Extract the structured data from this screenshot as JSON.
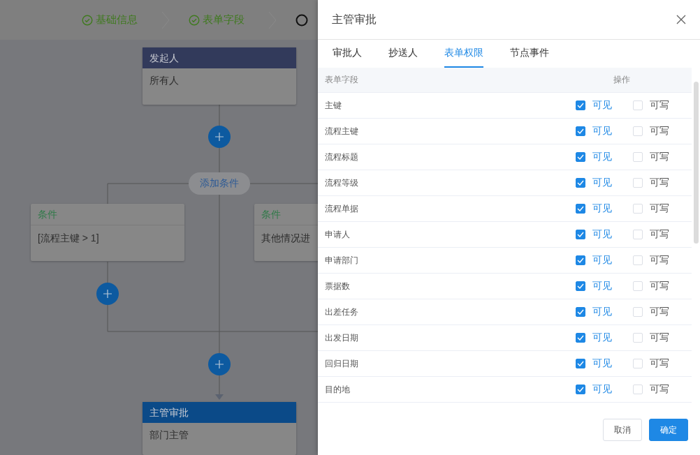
{
  "steps": [
    {
      "label": "基础信息",
      "done": true
    },
    {
      "label": "表单字段",
      "done": true
    },
    {
      "done": false
    }
  ],
  "flow": {
    "start_node": {
      "title": "发起人",
      "content": "所有人"
    },
    "add_condition": "添加条件",
    "conditions": [
      {
        "title": "条件",
        "content": "[流程主键 > 1]"
      },
      {
        "title": "条件",
        "content": "其他情况进"
      }
    ],
    "approver_node": {
      "title": "主管审批",
      "content": "部门主管"
    }
  },
  "drawer": {
    "title": "主管审批",
    "tabs": [
      {
        "label": "审批人",
        "selected": false
      },
      {
        "label": "抄送人",
        "selected": false
      },
      {
        "label": "表单权限",
        "selected": true
      },
      {
        "label": "节点事件",
        "selected": false
      }
    ],
    "table": {
      "columns": [
        "表单字段",
        "操作"
      ],
      "rows": [
        {
          "field": "主键",
          "visible": true,
          "visible_label": "可见",
          "writable": false,
          "writable_label": "可写"
        },
        {
          "field": "流程主键",
          "visible": true,
          "visible_label": "可见",
          "writable": false,
          "writable_label": "可写"
        },
        {
          "field": "流程标题",
          "visible": true,
          "visible_label": "可见",
          "writable": false,
          "writable_label": "可写"
        },
        {
          "field": "流程等级",
          "visible": true,
          "visible_label": "可见",
          "writable": false,
          "writable_label": "可写"
        },
        {
          "field": "流程单据",
          "visible": true,
          "visible_label": "可见",
          "writable": false,
          "writable_label": "可写"
        },
        {
          "field": "申请人",
          "visible": true,
          "visible_label": "可见",
          "writable": false,
          "writable_label": "可写"
        },
        {
          "field": "申请部门",
          "visible": true,
          "visible_label": "可见",
          "writable": false,
          "writable_label": "可写"
        },
        {
          "field": "票据数",
          "visible": true,
          "visible_label": "可见",
          "writable": false,
          "writable_label": "可写"
        },
        {
          "field": "出差任务",
          "visible": true,
          "visible_label": "可见",
          "writable": false,
          "writable_label": "可写"
        },
        {
          "field": "出发日期",
          "visible": true,
          "visible_label": "可见",
          "writable": false,
          "writable_label": "可写"
        },
        {
          "field": "回归日期",
          "visible": true,
          "visible_label": "可见",
          "writable": false,
          "writable_label": "可写"
        },
        {
          "field": "目的地",
          "visible": true,
          "visible_label": "可见",
          "writable": false,
          "writable_label": "可写"
        }
      ]
    },
    "buttons": [
      {
        "label": "取消",
        "kind": "default"
      },
      {
        "label": "确定",
        "kind": "primary"
      }
    ]
  }
}
